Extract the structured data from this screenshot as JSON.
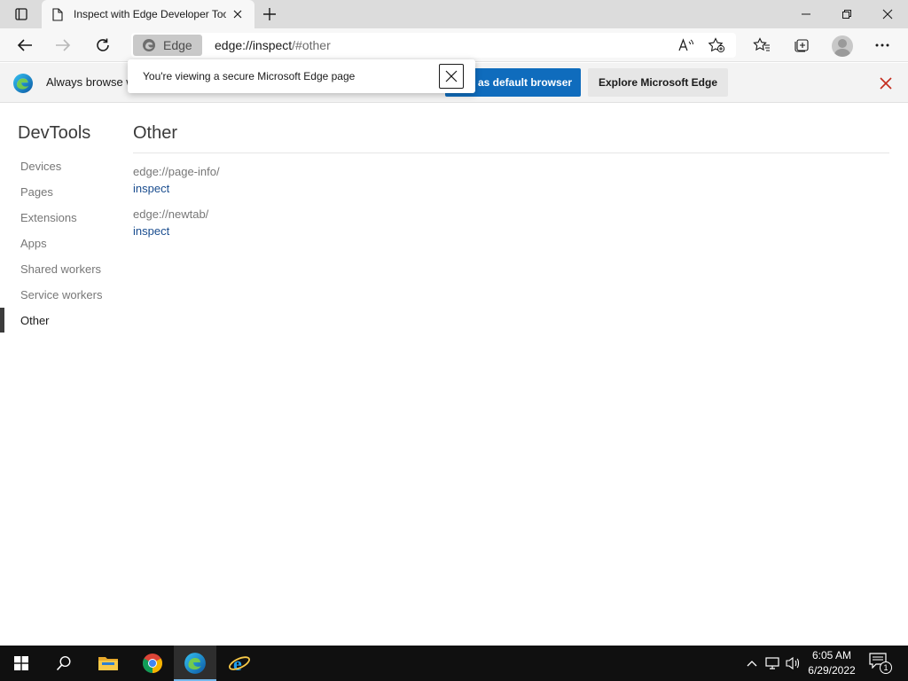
{
  "tab": {
    "title": "Inspect with Edge Developer Tools"
  },
  "address": {
    "chip": "Edge",
    "url_host": "edge://inspect",
    "url_rest": "/#other"
  },
  "popup": {
    "text": "You're viewing a secure Microsoft Edge page"
  },
  "infobar": {
    "message": "Always browse w",
    "primary_button": "as default browser",
    "secondary_button": "Explore Microsoft Edge"
  },
  "sidebar": {
    "title": "DevTools",
    "items": [
      {
        "label": "Devices"
      },
      {
        "label": "Pages"
      },
      {
        "label": "Extensions"
      },
      {
        "label": "Apps"
      },
      {
        "label": "Shared workers"
      },
      {
        "label": "Service workers"
      },
      {
        "label": "Other"
      }
    ],
    "active_item": "Other"
  },
  "main": {
    "title": "Other",
    "entries": [
      {
        "url": "edge://page-info/",
        "action": "inspect"
      },
      {
        "url": "edge://newtab/",
        "action": "inspect"
      }
    ]
  },
  "taskbar": {
    "time": "6:05 AM",
    "date": "6/29/2022",
    "notification_count": "1",
    "apps": [
      "start-icon",
      "search-icon",
      "file-explorer-icon",
      "chrome-icon",
      "edge-icon",
      "internet-explorer-icon"
    ]
  },
  "colors": {
    "accent": "#0f6cbd",
    "link": "#1a4d8f",
    "infobar_close": "#c42b1c",
    "taskbar": "#101010"
  }
}
